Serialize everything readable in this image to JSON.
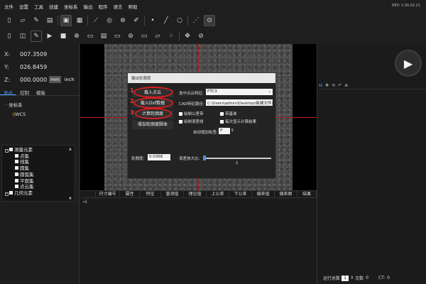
{
  "menu": [
    "文件",
    "设置",
    "工具",
    "创建",
    "坐标系",
    "输出",
    "程序",
    "语言",
    "帮助"
  ],
  "version": "REV: 1.00.02.21",
  "toolbar_row1": [
    {
      "icon": "new-icon",
      "glyph": "▯"
    },
    {
      "icon": "folder-icon",
      "glyph": "▱"
    },
    {
      "icon": "measure-icon",
      "glyph": "✎"
    },
    {
      "icon": "save-icon",
      "glyph": "▤"
    },
    {
      "icon": "monitor-icon",
      "glyph": "▣"
    },
    {
      "icon": "grid-icon",
      "glyph": "▦"
    },
    {
      "icon": "line-tool-icon",
      "glyph": "⟋"
    },
    {
      "icon": "circle-stack-icon",
      "glyph": "◎"
    },
    {
      "icon": "target-icon",
      "glyph": "⊛"
    },
    {
      "icon": "edit-icon",
      "glyph": "✐"
    },
    {
      "icon": "point-icon",
      "glyph": "•"
    },
    {
      "icon": "line-icon",
      "glyph": "╱"
    },
    {
      "icon": "circle-icon",
      "glyph": "○"
    },
    {
      "icon": "nodes-icon",
      "glyph": "⋰"
    },
    {
      "icon": "camera-icon",
      "glyph": "⊙"
    }
  ],
  "toolbar_row2": [
    {
      "icon": "page-icon",
      "glyph": "▯"
    },
    {
      "icon": "layers-icon",
      "glyph": "◫"
    },
    {
      "icon": "play-icon",
      "glyph": "▶"
    },
    {
      "icon": "stop-icon",
      "glyph": "■"
    },
    {
      "icon": "probe-icon",
      "glyph": "⊕"
    },
    {
      "icon": "image-icon",
      "glyph": "▭"
    },
    {
      "icon": "frame-icon",
      "glyph": "▤"
    },
    {
      "icon": "rect-icon",
      "glyph": "▭"
    },
    {
      "icon": "scan-icon",
      "glyph": "⊚"
    },
    {
      "icon": "rect2-icon",
      "glyph": "▭"
    },
    {
      "icon": "parallelogram-icon",
      "glyph": "▱"
    },
    {
      "icon": "dots-icon",
      "glyph": "⁘"
    },
    {
      "icon": "move-icon",
      "glyph": "✥"
    },
    {
      "icon": "trace-icon",
      "glyph": "⊘"
    }
  ],
  "coords": {
    "x_label": "X:",
    "x_value": "007.3509",
    "y_label": "Y:",
    "y_value": "026.8459",
    "z_label": "Z:",
    "z_value": "000.0000",
    "unit_mm": "mm",
    "unit_inch": "inch"
  },
  "left_tabs": [
    "显示",
    "控制",
    "模板"
  ],
  "coord_tree": {
    "root": "坐标系",
    "child": "WCS"
  },
  "elements": {
    "root": "测量元素",
    "children": [
      "点集",
      "线集",
      "圆集",
      "圆弧集",
      "平面集",
      "点云集"
    ],
    "next_group": "几何元素"
  },
  "dialog": {
    "title": "输出轮廓度",
    "btn_load_points": "载入点云",
    "btn_load_dxf": "载入Dxf数据",
    "btn_compute": "计算轮廓度",
    "btn_add_script": "增加轮廓度脚本",
    "num1": "1",
    "num2": "2",
    "num3": "3",
    "feature_label": "选中点云特征:",
    "feature_value": "PTC3",
    "cad_label": "CAD特征路径:",
    "cad_value": "C:\\Users\\admin\\Desktop\\新建文件夹\\",
    "cb_tolerance": "绘制公差带",
    "cb_baseline": "带基准",
    "cb_error": "绘制误差线",
    "cb_show_result": "每次显示计算结果",
    "auto_label": "自动增加标签:",
    "auto_value": "P",
    "profile_label": "轮廓度:",
    "profile_value": "0.0368",
    "scale_label": "误差放大比:",
    "scale_value": "1",
    "slider_level": 0.02
  },
  "table": {
    "columns": [
      "尺寸编号",
      "属性",
      "特征",
      "量测值",
      "理论值",
      "上公差",
      "下公差",
      "偏差值",
      "偏差图",
      "结果"
    ],
    "row1": "1"
  },
  "right_tools": [
    "⊟",
    "✥",
    "⟲",
    "↶",
    "⊕"
  ],
  "status": {
    "run_label": "运行总数",
    "run_value": "1",
    "count_label": "次数",
    "count_value": "0",
    "ct_label": "CT:",
    "ct_value": "0"
  },
  "colors": {
    "accent": "#4fa3ff",
    "annotation_red": "#d82020",
    "background": "#1b1b1b"
  }
}
